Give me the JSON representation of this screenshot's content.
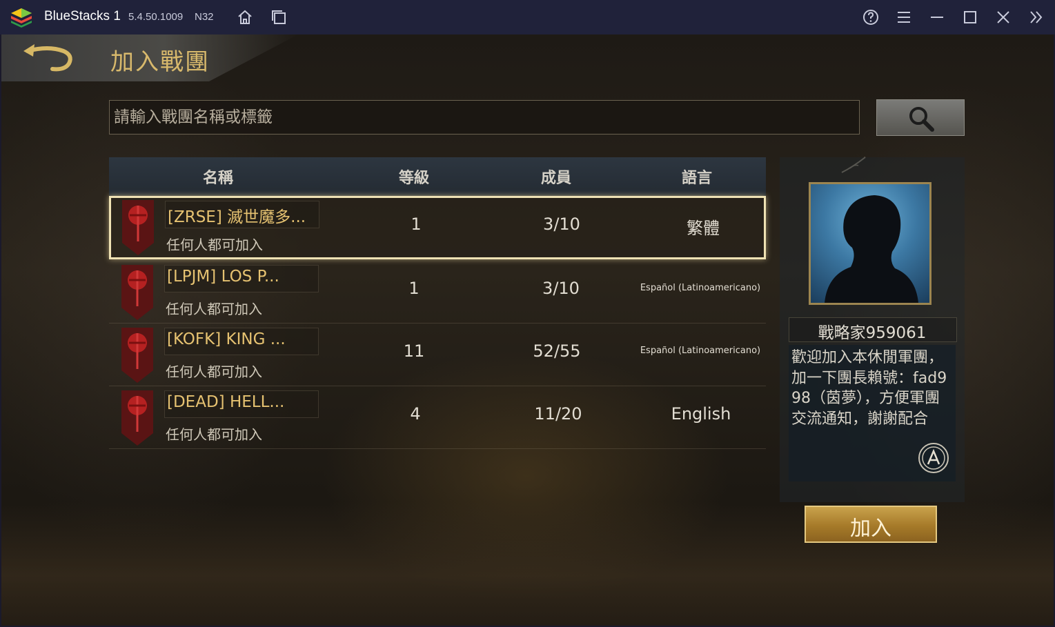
{
  "window": {
    "app_name": "BlueStacks 1",
    "version": "5.4.50.1009",
    "build": "N32"
  },
  "page": {
    "title": "加入戰團"
  },
  "search": {
    "placeholder": "請輸入戰團名稱或標籤"
  },
  "table": {
    "headers": [
      "名稱",
      "等級",
      "成員",
      "語言"
    ],
    "rows": [
      {
        "name": "[ZRSE] 滅世魔多...",
        "join_policy": "任何人都可加入",
        "level": "1",
        "members": "3/10",
        "language": "繁體",
        "selected": true
      },
      {
        "name": "[LPJM] LOS P...",
        "join_policy": "任何人都可加入",
        "level": "1",
        "members": "3/10",
        "language": "Español (Latinoamericano)",
        "selected": false
      },
      {
        "name": "[KOFK] KING ...",
        "join_policy": "任何人都可加入",
        "level": "11",
        "members": "52/55",
        "language": "Español (Latinoamericano)",
        "selected": false
      },
      {
        "name": "[DEAD] HELL...",
        "join_policy": "任何人都可加入",
        "level": "4",
        "members": "11/20",
        "language": "English",
        "selected": false
      }
    ]
  },
  "detail": {
    "leader_name": "戰略家959061",
    "description": "歡迎加入本休閒軍團，加一下團長賴號：fad998（茵夢），方便軍團交流通知，謝謝配合",
    "join_label": "加入"
  },
  "colors": {
    "titlebar_bg": "#20223a",
    "title_gold": "#d8b96c",
    "clan_name": "#e6c271",
    "selected_border": "#efe2b4"
  }
}
